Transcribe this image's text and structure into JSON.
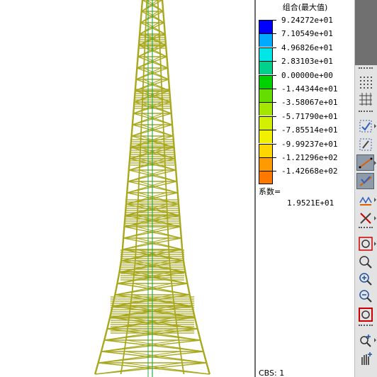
{
  "legend": {
    "title": "组合(最大值)",
    "colors": [
      "#0000ff",
      "#00aaff",
      "#00e5e5",
      "#00d28c",
      "#00d200",
      "#66dd00",
      "#a4e600",
      "#d2f000",
      "#f0f000",
      "#ffd700",
      "#ff9b00",
      "#ff7800",
      "#ff3200"
    ],
    "values": [
      "9.24272e+01",
      "7.10549e+01",
      "4.96826e+01",
      "2.83103e+01",
      "0.00000e+00",
      "-1.44344e+01",
      "-3.58067e+01",
      "-5.71790e+01",
      "-7.85514e+01",
      "-9.99237e+01",
      "-1.21296e+02",
      "-1.42668e+02"
    ],
    "factor_label": "系数=",
    "factor_value": "1.9521E+01"
  },
  "status": {
    "cbs": "CBS: 1"
  },
  "model": {
    "tower_color": "#a8a81e",
    "center_line_color": "#2ea84a"
  },
  "toolbar": {
    "tools": [
      {
        "name": "grid-dots-icon"
      },
      {
        "name": "grid-lines-icon"
      },
      {
        "name": "node-select-icon"
      },
      {
        "name": "element-select-icon"
      },
      {
        "name": "beam-display-icon",
        "active": true
      },
      {
        "name": "truss-display-icon",
        "active": true
      },
      {
        "name": "spring-display-icon"
      },
      {
        "name": "cross-display-icon"
      },
      {
        "name": "zoom-window-icon"
      },
      {
        "name": "zoom-dynamic-icon"
      },
      {
        "name": "zoom-in-icon"
      },
      {
        "name": "zoom-out-icon"
      },
      {
        "name": "zoom-fit-icon"
      },
      {
        "name": "pan-icon"
      },
      {
        "name": "hand-pan-icon"
      }
    ]
  }
}
